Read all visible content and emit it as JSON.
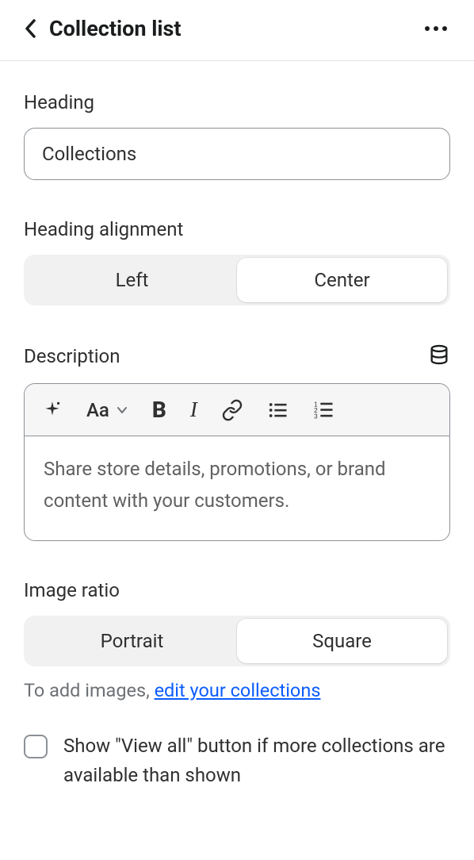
{
  "header": {
    "title": "Collection list"
  },
  "heading": {
    "label": "Heading",
    "value": "Collections"
  },
  "heading_alignment": {
    "label": "Heading alignment",
    "options": [
      "Left",
      "Center"
    ],
    "selected": "Center"
  },
  "description": {
    "label": "Description",
    "placeholder": "Share store details, promotions, or brand content with your customers."
  },
  "image_ratio": {
    "label": "Image ratio",
    "options": [
      "Portrait",
      "Square"
    ],
    "selected": "Square",
    "helper_prefix": "To add images, ",
    "helper_link": "edit your collections"
  },
  "view_all": {
    "label": "Show \"View all\" button if more collections are available than shown",
    "checked": false
  }
}
